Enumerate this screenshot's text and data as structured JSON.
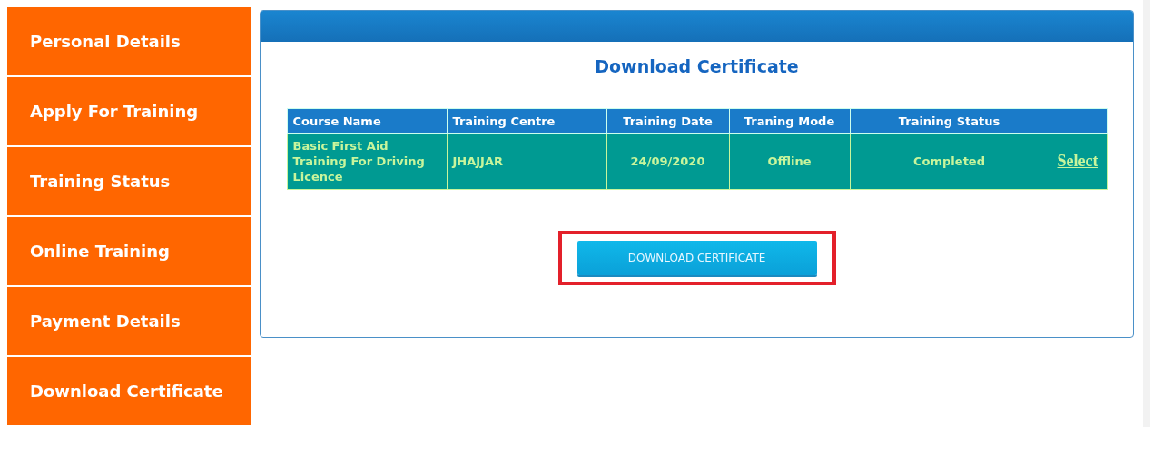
{
  "sidebar": {
    "items": [
      {
        "label": "Personal Details",
        "selected": false
      },
      {
        "label": "Apply For Training",
        "selected": false
      },
      {
        "label": "Training Status",
        "selected": false
      },
      {
        "label": "Online Training",
        "selected": false
      },
      {
        "label": "Payment Details",
        "selected": false
      },
      {
        "label": "Download Certificate",
        "selected": false
      }
    ]
  },
  "panel": {
    "title": "Download Certificate"
  },
  "table": {
    "columns": [
      "Course Name",
      "Training Centre",
      "Training Date",
      "Traning Mode",
      "Training Status"
    ],
    "rows": [
      {
        "cells": [
          "Basic First Aid Training For Driving Licence",
          "JHAJJAR",
          "24/09/2020",
          "Offline",
          "Completed"
        ],
        "action": "Select"
      }
    ]
  },
  "download_button": {
    "label": "DOWNLOAD CERTIFICATE",
    "highlighted": true
  }
}
